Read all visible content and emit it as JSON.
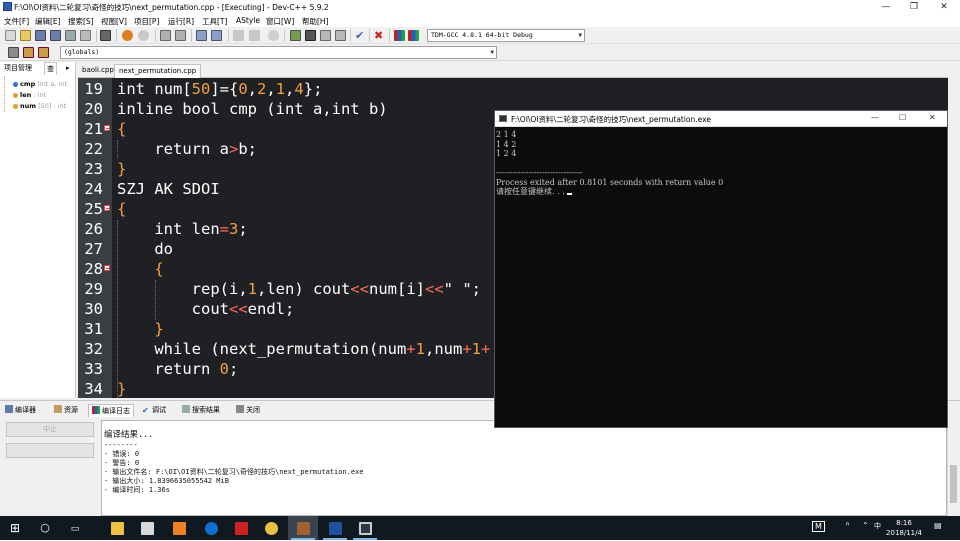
{
  "window": {
    "title": "F:\\OI\\OI资料\\二轮复习\\奇怪的技巧\\next_permutation.cpp - [Executing] - Dev-C++ 5.9.2",
    "minimize": "—",
    "maximize": "❐",
    "close": "✕"
  },
  "menu": {
    "items": [
      "文件[F]",
      "编辑[E]",
      "搜索[S]",
      "视图[V]",
      "项目[P]",
      "运行[R]",
      "工具[T]",
      "AStyle",
      "窗口[W]",
      "帮助[H]"
    ]
  },
  "toolbar": {
    "compiler": "TDM-GCC 4.8.1 64-bit Debug",
    "scope": "(globals)"
  },
  "left_panel": {
    "tab1": "项目管理",
    "tab2": "查",
    "classes": [
      {
        "name": "cmp",
        "detail": " (int a, int"
      },
      {
        "name": "len",
        "detail": " : int"
      },
      {
        "name": "num",
        "detail": " [50] : int"
      }
    ]
  },
  "editor": {
    "tabs": [
      "baoli.cpp",
      "next_permutation.cpp"
    ],
    "lines": [
      {
        "no": "19",
        "fold": false
      },
      {
        "no": "20",
        "fold": false
      },
      {
        "no": "21",
        "fold": true
      },
      {
        "no": "22",
        "fold": false
      },
      {
        "no": "23",
        "fold": false
      },
      {
        "no": "24",
        "fold": false
      },
      {
        "no": "25",
        "fold": true
      },
      {
        "no": "26",
        "fold": false
      },
      {
        "no": "27",
        "fold": false
      },
      {
        "no": "28",
        "fold": true
      },
      {
        "no": "29",
        "fold": false
      },
      {
        "no": "30",
        "fold": false
      },
      {
        "no": "31",
        "fold": false
      },
      {
        "no": "32",
        "fold": false
      },
      {
        "no": "33",
        "fold": false
      },
      {
        "no": "34",
        "fold": false
      }
    ],
    "code": {
      "l19": {
        "a": "int num[",
        "b": "50",
        "c": "]={",
        "d": "0",
        "e": ",",
        "f": "2",
        "g": ",",
        "h": "1",
        "i": ",",
        "j": "4",
        "k": "};"
      },
      "l20": "inline bool cmp (int a,int b)",
      "l21": "{",
      "l22": {
        "a": "    return a",
        "b": ">",
        "c": "b;"
      },
      "l23": "}",
      "l24": "SZJ AK SDOI",
      "l25": "{",
      "l26": {
        "a": "    int len",
        "b": "=",
        "c": "3",
        "d": ";"
      },
      "l27": "    do",
      "l28": "    {",
      "l29": {
        "a": "        rep(i,",
        "b": "1",
        "c": ",len) cout",
        "d": "<<",
        "e": "num[i]",
        "f": "<<",
        "g": "\" \";"
      },
      "l30": {
        "a": "        cout",
        "b": "<<",
        "c": "endl;"
      },
      "l31": "    }",
      "l32": {
        "a": "    while (next_permutation(num",
        "b": "+",
        "c": "1",
        "d": ",num",
        "e": "+",
        "f": "1",
        "g": "+"
      },
      "l33": {
        "a": "    return ",
        "b": "0",
        "c": ";"
      },
      "l34": "}"
    }
  },
  "bottom": {
    "tabs": [
      "编译器",
      "资源",
      "编译日志",
      "调试",
      "搜索结果",
      "关闭"
    ],
    "abort_button": "中止",
    "log_title": "编译结果...",
    "log_lines": [
      "--------",
      "- 错误: 0",
      "- 警告: 0",
      "- 输出文件名: F:\\OI\\OI资料\\二轮复习\\奇怪的技巧\\next_permutation.exe",
      "- 输出大小: 1.8396635055542 MiB",
      "- 编译时间: 1.36s"
    ]
  },
  "console": {
    "title": "F:\\OI\\OI资料\\二轮复习\\奇怪的技巧\\next_permutation.exe",
    "output": "2 1 4\n1 4 2\n1 2 4\n\n--------------------------------\nProcess exited after 0.8101 seconds with return value 0\n请按任意键继续. . . ",
    "minimize": "—",
    "maximize": "☐",
    "close": "✕"
  },
  "taskbar": {
    "time": "8:16",
    "date": "2018/11/4",
    "ime": "M",
    "ime2": "中"
  }
}
